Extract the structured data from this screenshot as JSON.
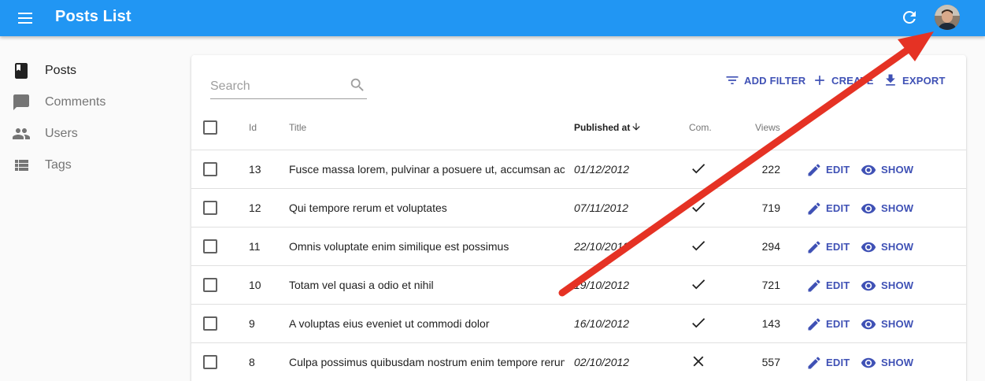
{
  "appbar": {
    "title": "Posts List",
    "menu_icon": "menu-icon",
    "refresh_icon": "refresh-icon",
    "avatar": "user-avatar"
  },
  "sidebar": {
    "items": [
      {
        "label": "Posts",
        "icon": "book-icon",
        "active": true
      },
      {
        "label": "Comments",
        "icon": "comment-icon",
        "active": false
      },
      {
        "label": "Users",
        "icon": "people-icon",
        "active": false
      },
      {
        "label": "Tags",
        "icon": "list-icon",
        "active": false
      }
    ]
  },
  "search": {
    "placeholder": "Search",
    "value": ""
  },
  "toolbar": {
    "add_filter": "ADD FILTER",
    "create": "CREATE",
    "export": "EXPORT"
  },
  "table": {
    "columns": [
      "Id",
      "Title",
      "Published at",
      "Com.",
      "Views"
    ],
    "sorted_column": "Published at",
    "sort_direction": "desc",
    "edit_label": "EDIT",
    "show_label": "SHOW",
    "rows": [
      {
        "id": "13",
        "title": "Fusce massa lorem, pulvinar a posuere ut, accumsan ac",
        "published_at": "01/12/2012",
        "commentable": true,
        "views": "222"
      },
      {
        "id": "12",
        "title": "Qui tempore rerum et voluptates",
        "published_at": "07/11/2012",
        "commentable": true,
        "views": "719"
      },
      {
        "id": "11",
        "title": "Omnis voluptate enim similique est possimus",
        "published_at": "22/10/2012",
        "commentable": true,
        "views": "294"
      },
      {
        "id": "10",
        "title": "Totam vel quasi a odio et nihil",
        "published_at": "19/10/2012",
        "commentable": true,
        "views": "721"
      },
      {
        "id": "9",
        "title": "A voluptas eius eveniet ut commodi dolor",
        "published_at": "16/10/2012",
        "commentable": true,
        "views": "143"
      },
      {
        "id": "8",
        "title": "Culpa possimus quibusdam nostrum enim tempore rerum",
        "published_at": "02/10/2012",
        "commentable": false,
        "views": "557"
      }
    ]
  },
  "colors": {
    "appbar": "#2196f3",
    "accent": "#3f51b5",
    "annotation_arrow": "#e53224"
  }
}
